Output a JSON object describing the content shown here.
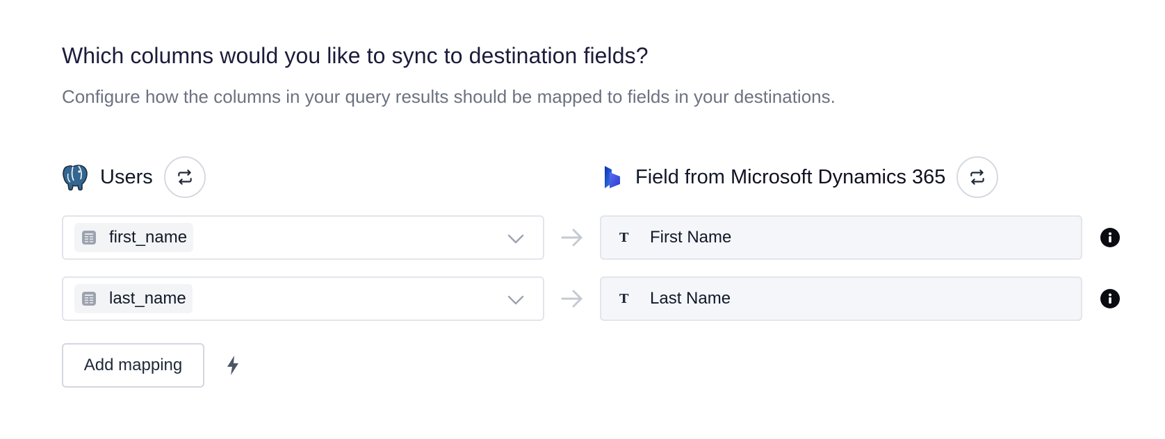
{
  "heading": {
    "title": "Which columns would you like to sync to destination fields?",
    "subtitle": "Configure how the columns in your query results should be mapped to fields in your destinations."
  },
  "source": {
    "label": "Users",
    "logo_icon": "postgres-elephant-icon",
    "swap_icon": "swap-icon"
  },
  "destination": {
    "prefix": "Field from",
    "name": "Microsoft Dynamics 365",
    "logo_icon": "dynamics-365-icon",
    "swap_icon": "swap-icon"
  },
  "mappings": [
    {
      "source_column": "first_name",
      "column_icon": "table-column-icon",
      "destination_field": "First Name",
      "field_type_icon": "text-type-icon",
      "type_glyph": "T"
    },
    {
      "source_column": "last_name",
      "column_icon": "table-column-icon",
      "destination_field": "Last Name",
      "field_type_icon": "text-type-icon",
      "type_glyph": "T"
    }
  ],
  "actions": {
    "add_mapping_label": "Add mapping",
    "auto_map_icon": "lightning-bolt-icon"
  },
  "colors": {
    "title": "#1d1b3a",
    "subtitle": "#6b7280",
    "border": "#e2e5ea",
    "dest_bg": "#f4f6fa",
    "chip_bg": "#f3f4f6",
    "dynamics_blue": "#3b5bdb"
  }
}
